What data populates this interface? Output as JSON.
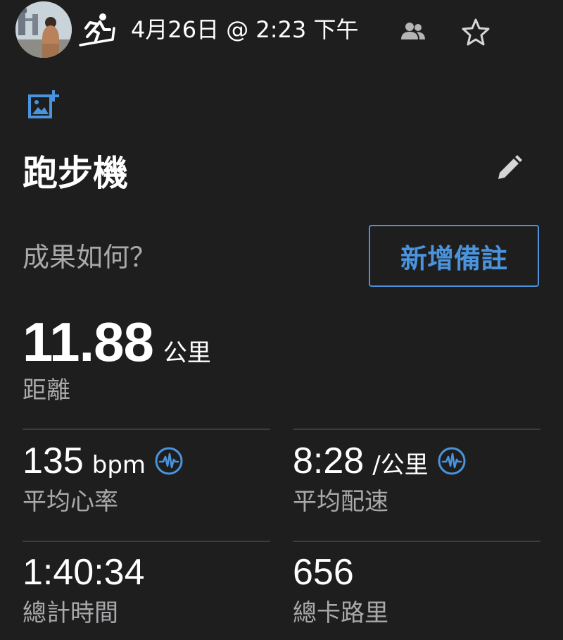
{
  "header": {
    "avatar_icon": "user-avatar",
    "activity_icon": "treadmill-runner-icon",
    "date_time": "4月26日 @ 2:23 下午",
    "group_icon": "people-icon",
    "star_icon": "star-outline-icon"
  },
  "add_photo_icon": "add-photo-icon",
  "activity": {
    "title": "跑步機",
    "edit_icon": "pencil-icon"
  },
  "note": {
    "prompt": "成果如何？",
    "button_label": "新增備註"
  },
  "distance": {
    "value": "11.88",
    "unit": "公里",
    "label": "距離"
  },
  "stats": [
    {
      "value": "135",
      "unit": "bpm",
      "label": "平均心率",
      "icon": "heart-rate-icon"
    },
    {
      "value": "8:28",
      "unit": "/公里",
      "label": "平均配速",
      "icon": "heart-rate-icon"
    },
    {
      "value": "1:40:34",
      "unit": "",
      "label": "總計時間"
    },
    {
      "value": "656",
      "unit": "",
      "label": "總卡路里"
    }
  ],
  "colors": {
    "background": "#1e1e1f",
    "accent": "#4a93dd",
    "secondary_text": "#a9a9ab",
    "divider": "#3c3c3e"
  }
}
